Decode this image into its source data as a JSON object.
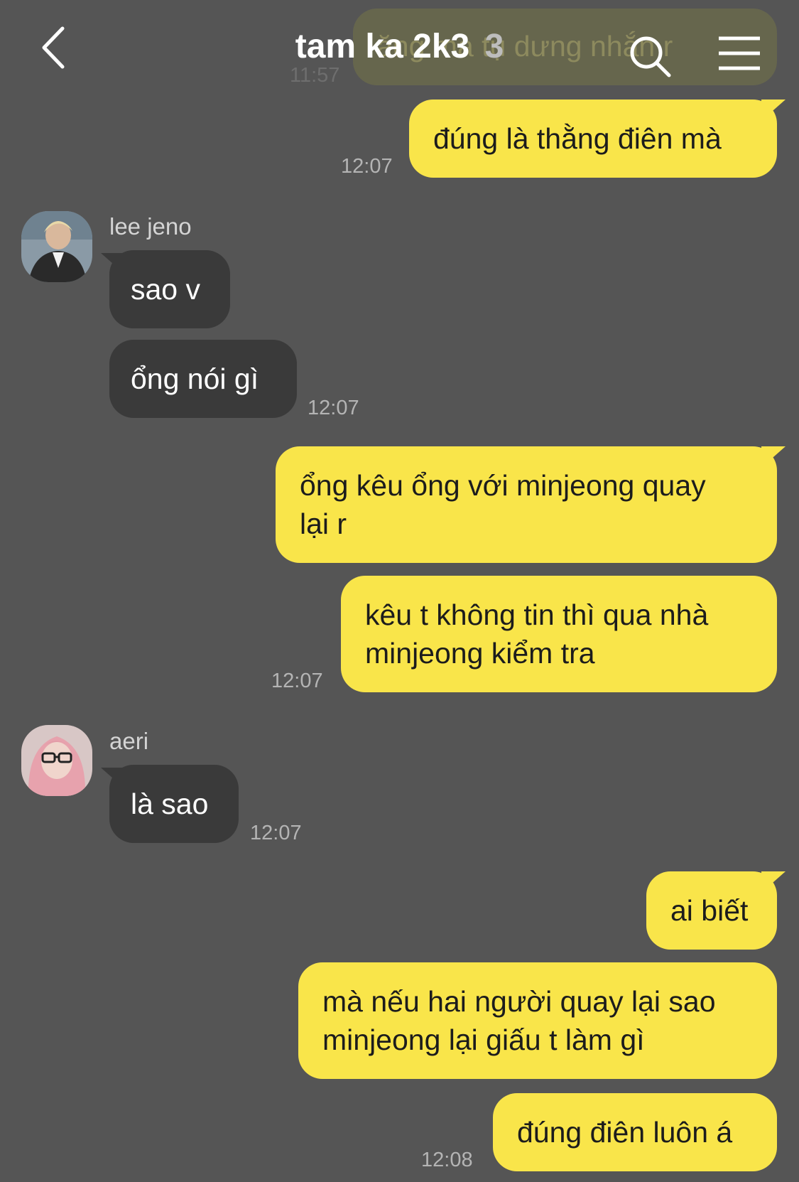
{
  "header": {
    "title": "tam ka 2k3",
    "member_count": "3",
    "ghost_text": "ăng mà tụ dưng nhắn r",
    "ghost_time": "11:57"
  },
  "messages": [
    {
      "side": "me",
      "text": "đúng là thằng điên mà",
      "time": "12:07"
    },
    {
      "side": "other",
      "sender": "lee jeno",
      "text": "sao v"
    },
    {
      "side": "other",
      "text": "ổng nói gì",
      "time": "12:07"
    },
    {
      "side": "me",
      "lines": [
        "ổng kêu ổng với minjeong quay",
        "lại r"
      ]
    },
    {
      "side": "me",
      "lines": [
        "kêu t không tin thì qua nhà",
        "minjeong kiểm tra"
      ],
      "time": "12:07"
    },
    {
      "side": "other",
      "sender": "aeri",
      "text": "là sao",
      "time": "12:07"
    },
    {
      "side": "me",
      "text": "ai biết"
    },
    {
      "side": "me",
      "lines": [
        "mà nếu hai người quay lại sao",
        "minjeong lại giấu t làm gì"
      ]
    },
    {
      "side": "me",
      "text": "đúng điên luôn á",
      "time": "12:08"
    }
  ],
  "colors": {
    "background": "#555555",
    "my_bubble": "#f9e54a",
    "other_bubble": "#3a3a3a"
  }
}
